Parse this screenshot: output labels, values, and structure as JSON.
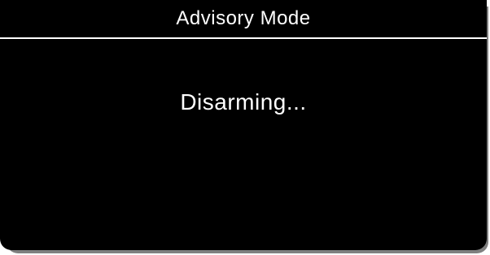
{
  "dialog": {
    "title": "Advisory Mode",
    "status_message": "Disarming..."
  }
}
